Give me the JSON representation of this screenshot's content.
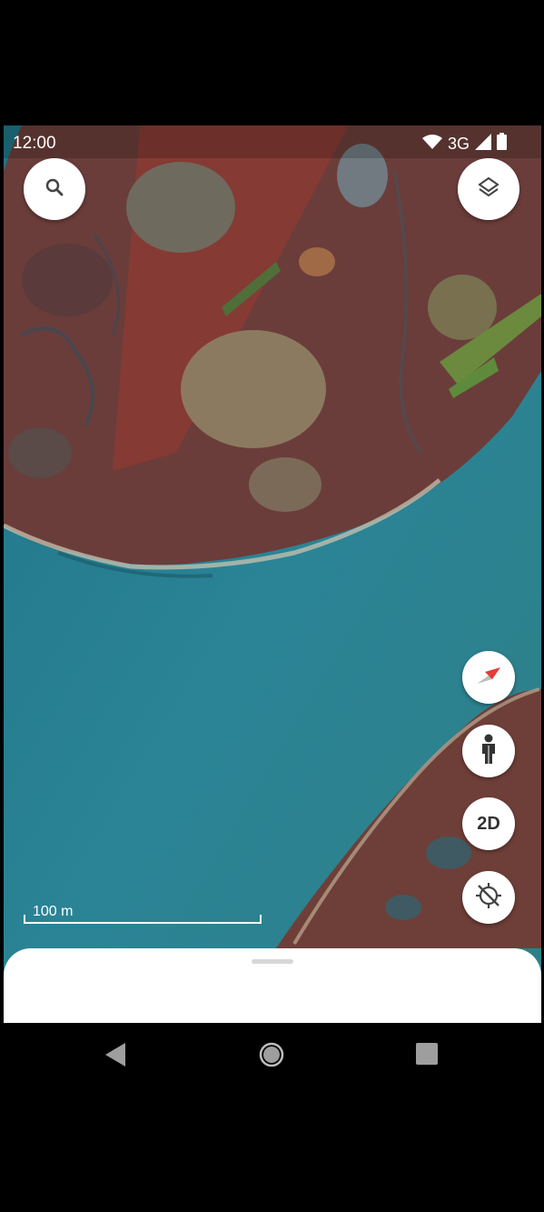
{
  "status_bar": {
    "time": "12:00",
    "network": "3G"
  },
  "map": {
    "scale_label": "100 m",
    "water_color": "#2a7f8c",
    "land_color": "#6b3c38"
  },
  "controls": {
    "search_icon": "search-icon",
    "layers_icon": "layers-icon",
    "compass_icon": "compass-icon",
    "street_view_icon": "pegman-icon",
    "view_mode_label": "2D",
    "location_icon": "location-off-icon"
  },
  "nav": {
    "back": "back-icon",
    "home": "home-icon",
    "recents": "recents-icon"
  }
}
